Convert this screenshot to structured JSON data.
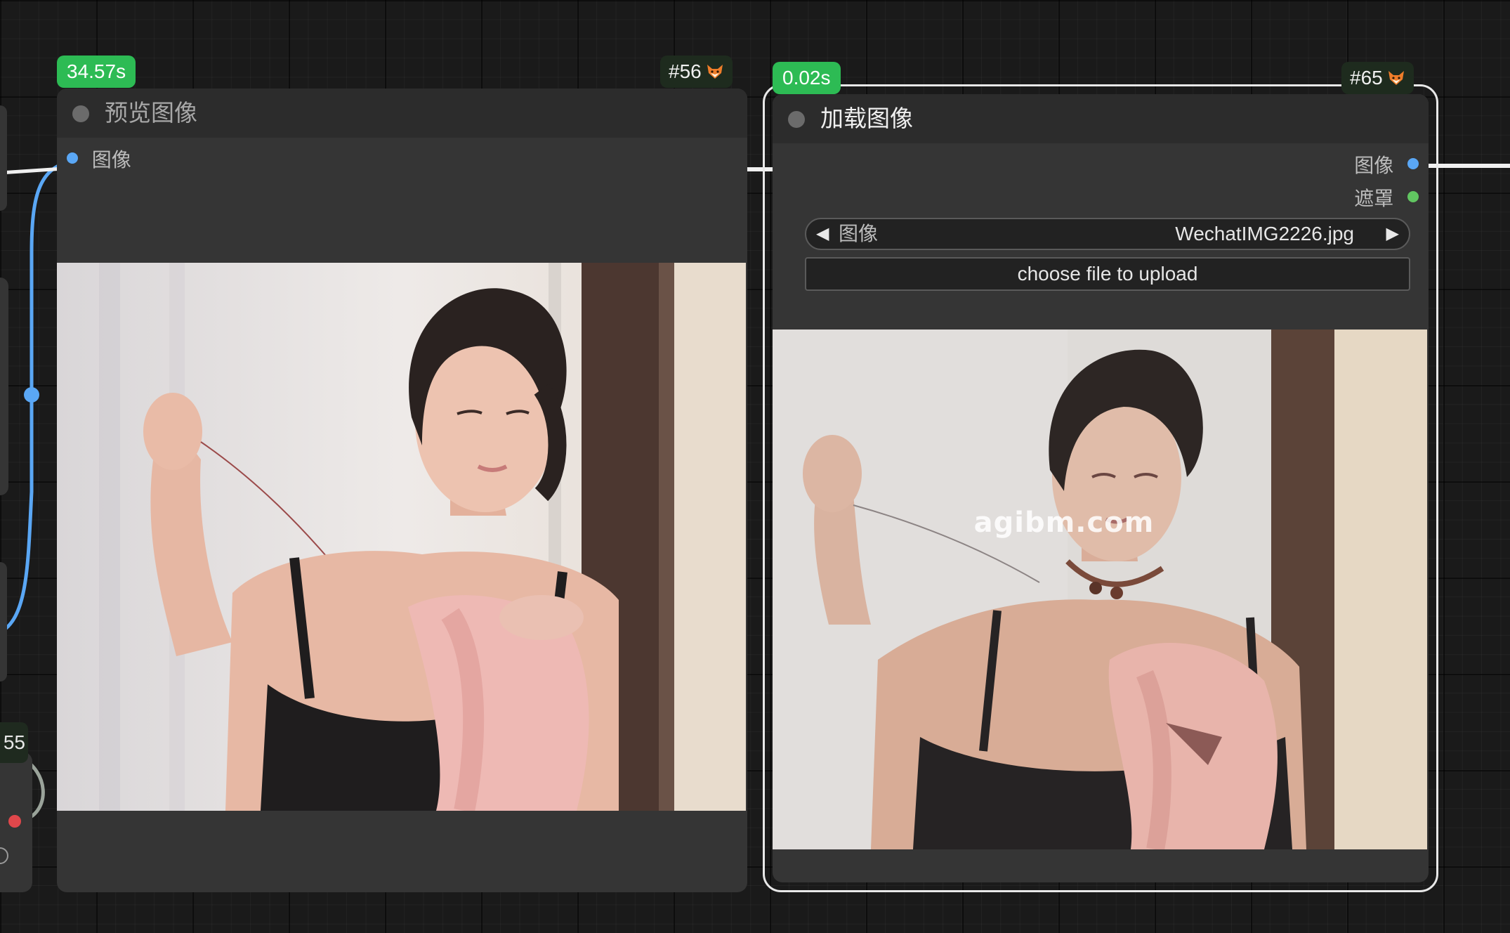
{
  "nodes": {
    "preview": {
      "time_badge": "34.57s",
      "id_badge": "#56",
      "title": "预览图像",
      "input_label": "图像"
    },
    "load": {
      "time_badge": "0.02s",
      "id_badge": "#65",
      "title": "加载图像",
      "outputs": {
        "image": "图像",
        "mask": "遮罩"
      },
      "image_widget": {
        "label": "图像",
        "value": "WechatIMG2226.jpg"
      },
      "upload_button": "choose file to upload",
      "watermark": "agibm.com"
    }
  },
  "left_edge": {
    "partial_badge": "55"
  },
  "icons": {
    "id_badge_icon": "fox-icon",
    "prev_arrow": "◀",
    "next_arrow": "▶"
  },
  "colors": {
    "time_badge": "#2dbb54",
    "image_socket": "#5aa7f5",
    "mask_socket": "#61c561",
    "red_socket": "#e0474b",
    "selection": "#e8e8e8"
  }
}
